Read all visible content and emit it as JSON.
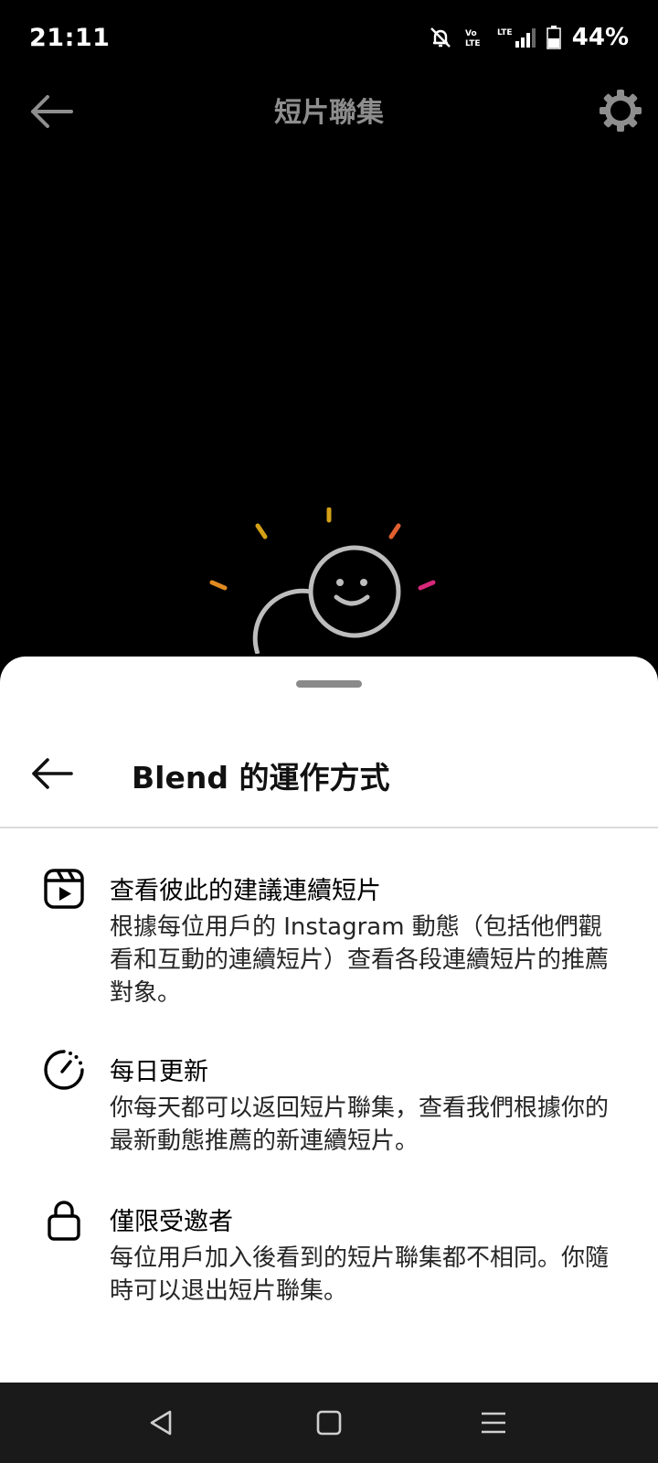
{
  "status_bar": {
    "time": "21:11",
    "battery_percent": "44%",
    "icons": [
      "bell-off-icon",
      "volte-icon",
      "lte-signal-icon",
      "battery-icon"
    ]
  },
  "top_bar": {
    "title": "短片聯集",
    "back_icon": "arrow-left-icon",
    "settings_icon": "gear-icon"
  },
  "sheet": {
    "title": "Blend 的運作方式",
    "features": [
      {
        "icon": "reels-icon",
        "title": "查看彼此的建議連續短片",
        "description": "根據每位用戶的 Instagram 動態（包括他們觀看和互動的連續短片）查看各段連續短片的推薦對象。"
      },
      {
        "icon": "timer-icon",
        "title": "每日更新",
        "description": "你每天都可以返回短片聯集，查看我們根據你的最新動態推薦的新連續短片。"
      },
      {
        "icon": "lock-icon",
        "title": "僅限受邀者",
        "description": "每位用戶加入後看到的短片聯集都不相同。你隨時可以退出短片聯集。"
      }
    ]
  },
  "nav_bar": {
    "buttons": [
      "back-triangle-icon",
      "home-square-icon",
      "recents-menu-icon"
    ]
  },
  "colors": {
    "background": "#000000",
    "sheet": "#ffffff",
    "accent_yellow": "#d4a017",
    "accent_orange": "#e86a2a",
    "accent_red": "#e03a3a",
    "accent_pink": "#d8287a"
  }
}
